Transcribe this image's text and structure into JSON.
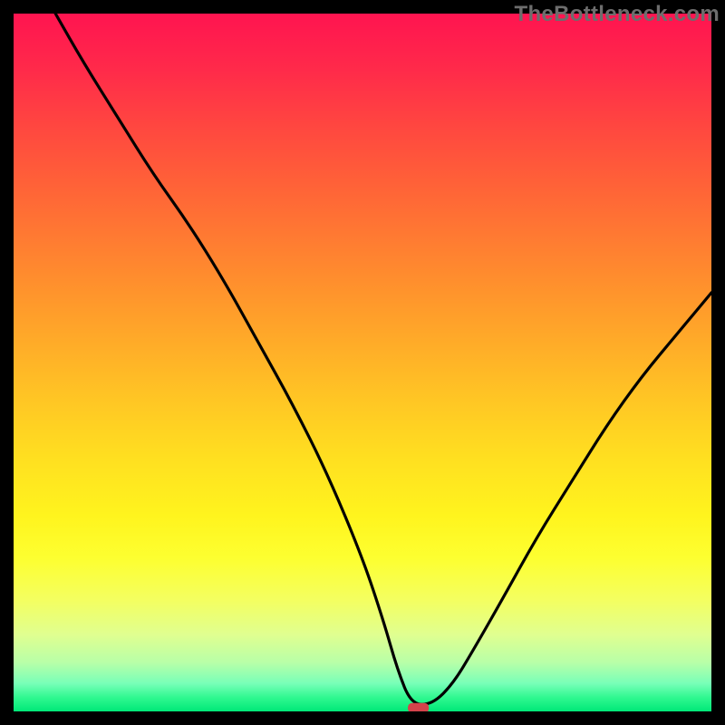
{
  "watermark": "TheBottleneck.com",
  "colors": {
    "frame": "#000000",
    "curve": "#000000",
    "marker": "#d4434b",
    "gradient_top": "#ff1450",
    "gradient_mid": "#ffe020",
    "gradient_bottom": "#00e878"
  },
  "chart_data": {
    "type": "line",
    "title": "",
    "xlabel": "",
    "ylabel": "",
    "xlim": [
      0,
      100
    ],
    "ylim": [
      0,
      100
    ],
    "grid": false,
    "note": "Background gradient encodes value from high (red, top) to low (green, bottom). Curve shows a V-shaped dip reaching minimum near x≈58.",
    "series": [
      {
        "name": "bottleneck-curve",
        "x": [
          6,
          10,
          15,
          20,
          25,
          30,
          35,
          40,
          45,
          50,
          53,
          55,
          57,
          60,
          63,
          66,
          70,
          75,
          80,
          85,
          90,
          95,
          100
        ],
        "y": [
          100,
          93,
          85,
          77,
          70,
          62,
          53,
          44,
          34,
          22,
          13,
          6,
          1,
          1,
          4,
          9,
          16,
          25,
          33,
          41,
          48,
          54,
          60
        ]
      }
    ],
    "marker": {
      "x": 58,
      "y": 0.5,
      "shape": "rounded-rect"
    }
  }
}
